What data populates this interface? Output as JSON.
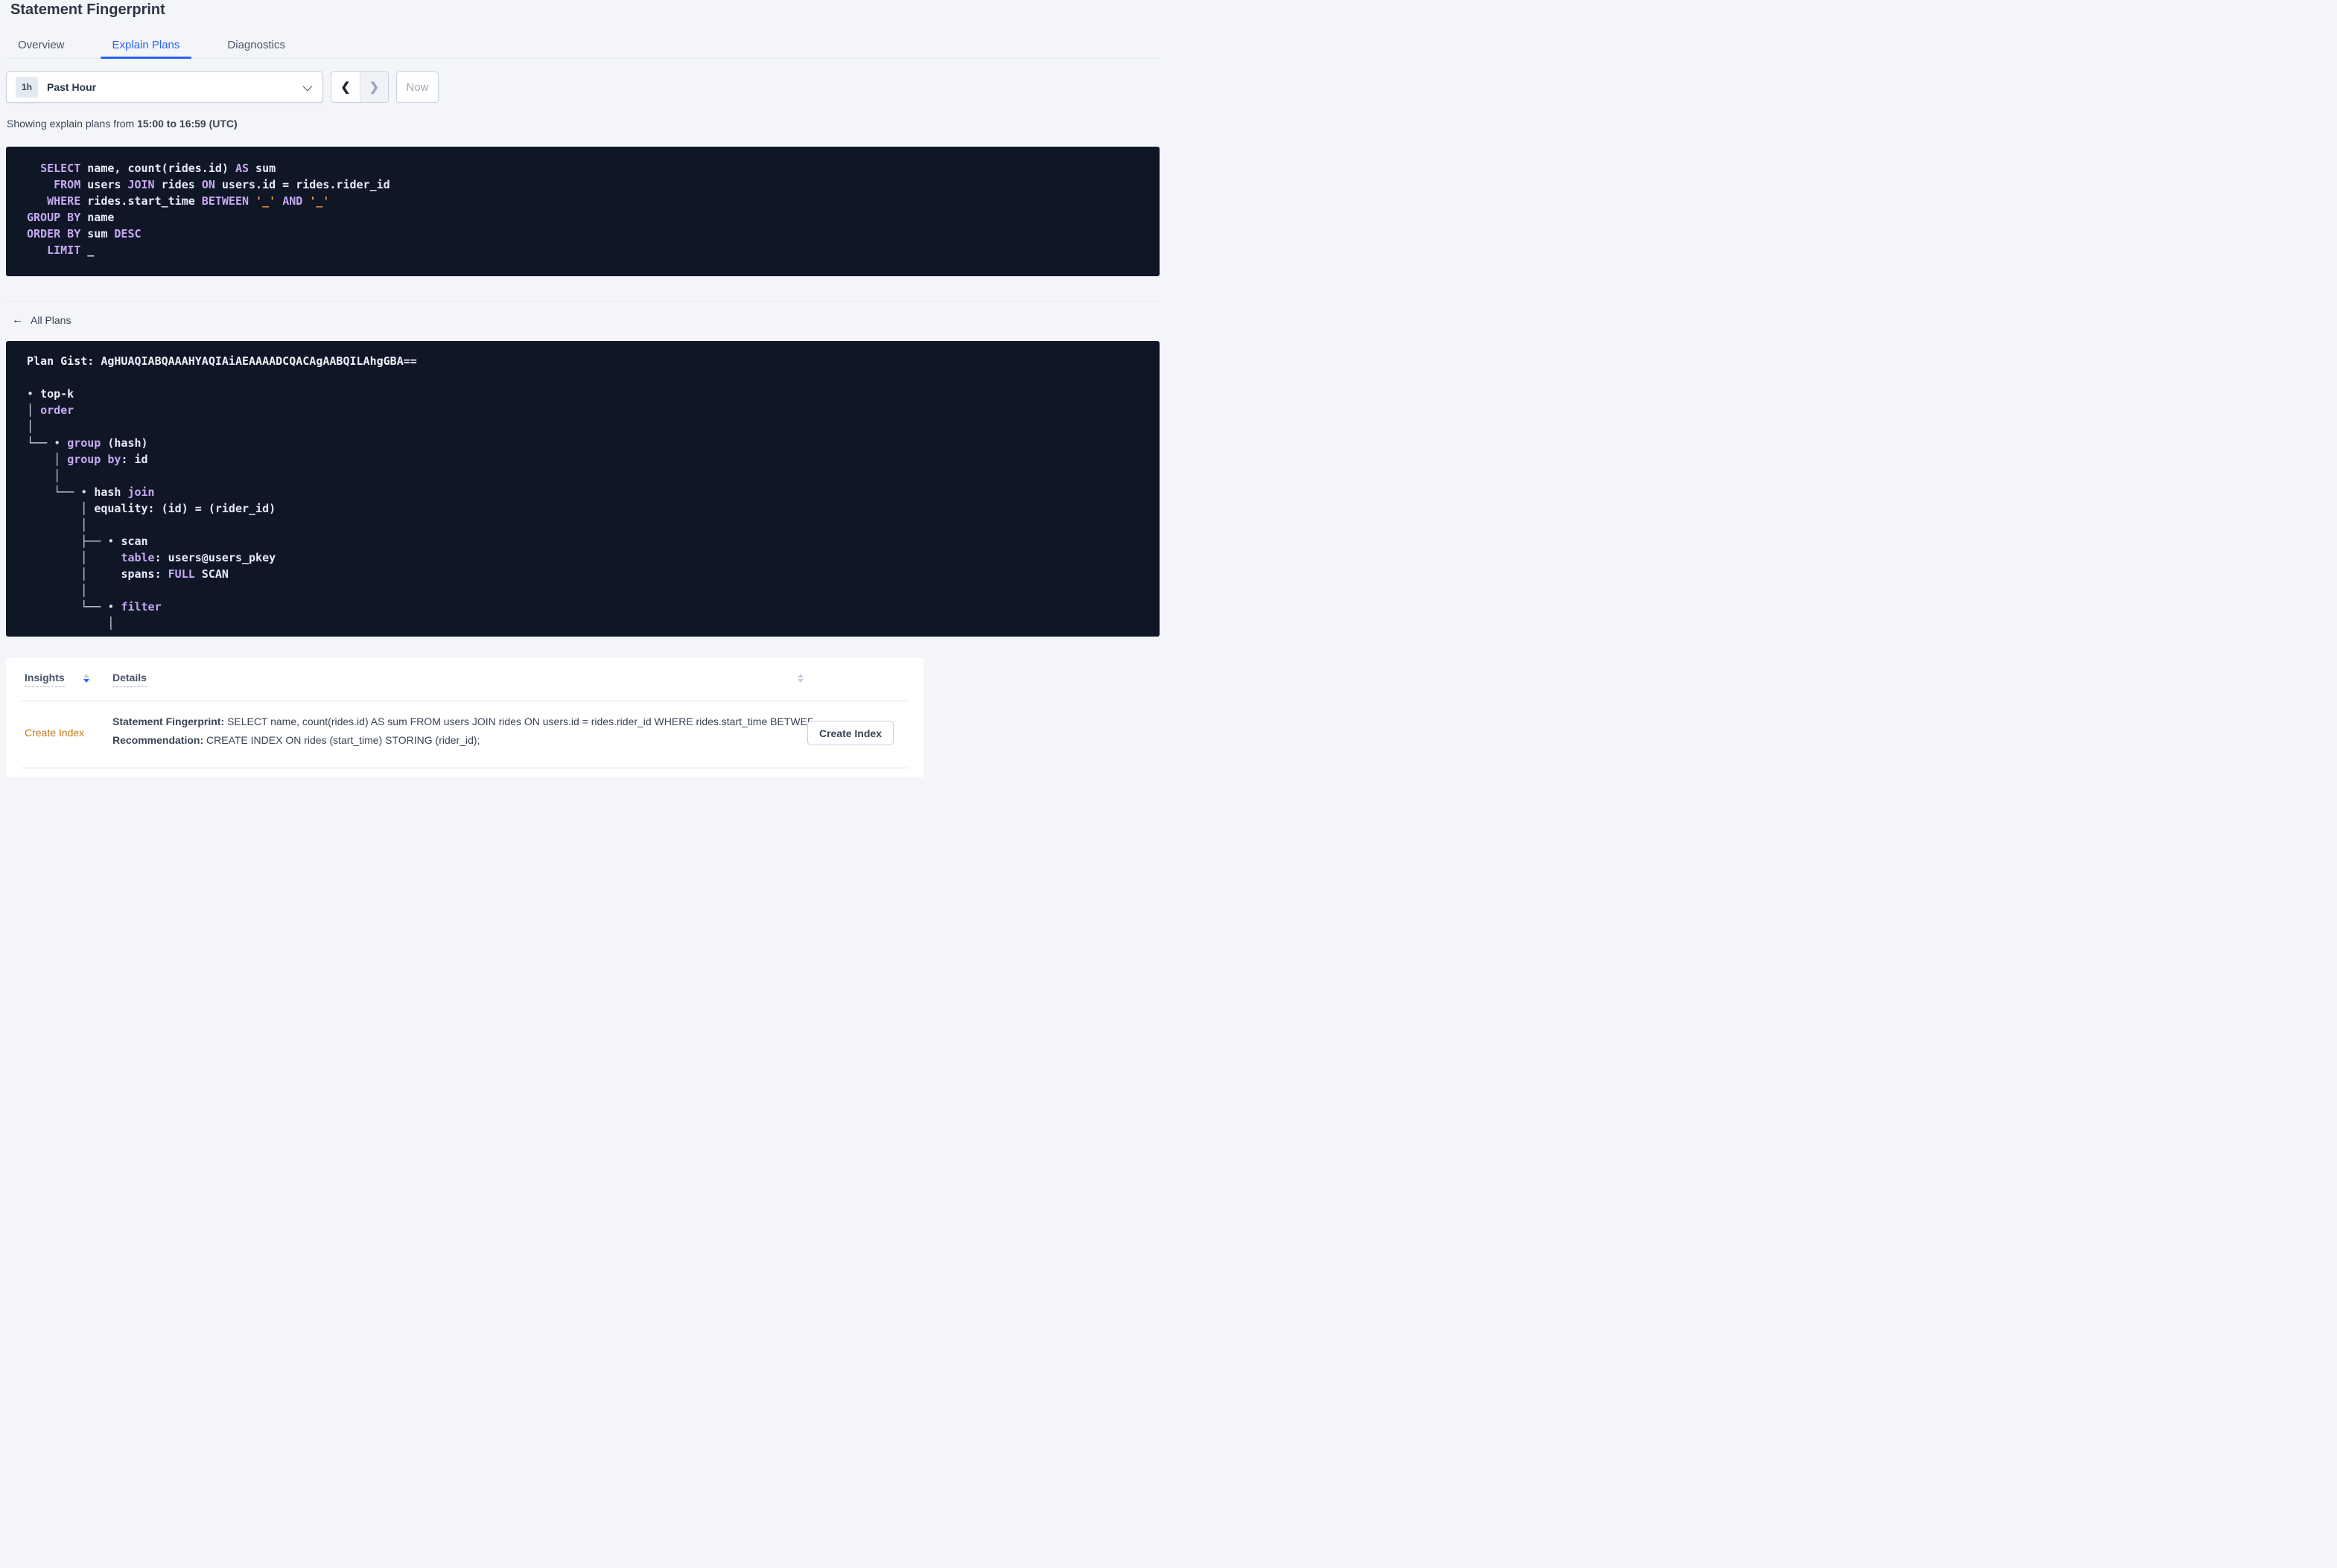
{
  "page": {
    "title": "Statement Fingerprint"
  },
  "tabs": [
    {
      "label": "Overview",
      "active": false
    },
    {
      "label": "Explain Plans",
      "active": true
    },
    {
      "label": "Diagnostics",
      "active": false
    }
  ],
  "time_picker": {
    "badge": "1h",
    "label": "Past Hour",
    "prev_icon": "❮",
    "next_icon": "❯",
    "now_label": "Now"
  },
  "showing": {
    "prefix": "Showing explain plans from ",
    "range": "15:00 to 16:59 (UTC)"
  },
  "sql": {
    "lines": [
      [
        [
          "  ",
          "id"
        ],
        [
          "SELECT",
          "kw"
        ],
        [
          " name, count(rides.id) ",
          "id"
        ],
        [
          "AS",
          "kw"
        ],
        [
          " sum",
          "id"
        ]
      ],
      [
        [
          "    ",
          "id"
        ],
        [
          "FROM",
          "kw"
        ],
        [
          " users ",
          "id"
        ],
        [
          "JOIN",
          "kw"
        ],
        [
          " rides ",
          "id"
        ],
        [
          "ON",
          "kw"
        ],
        [
          " users.id = rides.rider_id",
          "id"
        ]
      ],
      [
        [
          "   ",
          "id"
        ],
        [
          "WHERE",
          "kw"
        ],
        [
          " rides.start_time ",
          "id"
        ],
        [
          "BETWEEN",
          "kw"
        ],
        [
          " ",
          "id"
        ],
        [
          "'_'",
          "lit"
        ],
        [
          " ",
          "id"
        ],
        [
          "AND",
          "kw"
        ],
        [
          " ",
          "id"
        ],
        [
          "'_'",
          "lit"
        ]
      ],
      [
        [
          "GROUP BY",
          "kw"
        ],
        [
          " name",
          "id"
        ]
      ],
      [
        [
          "ORDER BY",
          "kw"
        ],
        [
          " sum ",
          "id"
        ],
        [
          "DESC",
          "kw"
        ]
      ],
      [
        [
          "   ",
          "id"
        ],
        [
          "LIMIT",
          "kw"
        ],
        [
          " _",
          "id"
        ]
      ]
    ]
  },
  "all_plans": {
    "label": "All Plans",
    "arrow_icon": "←"
  },
  "plan": {
    "gist": "AgHUAQIABQAAAHYAQIAiAEAAAADCQACAgAABQILAhgGBA==",
    "lines": [
      [
        [
          "Plan Gist: AgHUAQIABQAAAHYAQIAiAEAAAADCQACAgAABQILAhgGBA==",
          "b"
        ]
      ],
      [
        [
          "",
          ""
        ]
      ],
      [
        [
          "• ",
          "ln"
        ],
        [
          "top-k",
          "b"
        ]
      ],
      [
        [
          "│ ",
          "ln"
        ],
        [
          "order",
          "kw"
        ]
      ],
      [
        [
          "│",
          "ln"
        ]
      ],
      [
        [
          "└── ",
          "ln"
        ],
        [
          "• ",
          "ln"
        ],
        [
          "group",
          "kw"
        ],
        [
          " (hash)",
          "id"
        ]
      ],
      [
        [
          "    ",
          "id"
        ],
        [
          "│ ",
          "ln"
        ],
        [
          "group by",
          "kw"
        ],
        [
          ": id",
          "id"
        ]
      ],
      [
        [
          "    │",
          "ln"
        ]
      ],
      [
        [
          "    ",
          "id"
        ],
        [
          "└── ",
          "ln"
        ],
        [
          "• ",
          "ln"
        ],
        [
          "hash ",
          "id"
        ],
        [
          "join",
          "kw"
        ]
      ],
      [
        [
          "        ",
          "id"
        ],
        [
          "│ ",
          "ln"
        ],
        [
          "equality: (id) = (rider_id)",
          "id"
        ]
      ],
      [
        [
          "        │",
          "ln"
        ]
      ],
      [
        [
          "        ",
          "id"
        ],
        [
          "├── ",
          "ln"
        ],
        [
          "• ",
          "ln"
        ],
        [
          "scan",
          "id"
        ]
      ],
      [
        [
          "        ",
          "id"
        ],
        [
          "│     ",
          "ln"
        ],
        [
          "table",
          "kw"
        ],
        [
          ": users@users_pkey",
          "id"
        ]
      ],
      [
        [
          "        ",
          "id"
        ],
        [
          "│     ",
          "ln"
        ],
        [
          "spans: ",
          "id"
        ],
        [
          "FULL",
          "kw"
        ],
        [
          " SCAN",
          "id"
        ]
      ],
      [
        [
          "        │",
          "ln"
        ]
      ],
      [
        [
          "        ",
          "id"
        ],
        [
          "└── ",
          "ln"
        ],
        [
          "• ",
          "ln"
        ],
        [
          "filter",
          "kw"
        ]
      ],
      [
        [
          "            │",
          "ln"
        ]
      ]
    ]
  },
  "insights_table": {
    "columns": [
      {
        "label": "Insights",
        "sort": "desc"
      },
      {
        "label": "Details",
        "sort": "none"
      }
    ],
    "rows": [
      {
        "insight": "Create Index",
        "line1_label": "Statement Fingerprint:",
        "line1_text": " SELECT name, count(rides.id) AS sum FROM users JOIN rides ON users.id = rides.rider_id WHERE rides.start_time BETWEEN '_…",
        "line2_label": "Recommendation:",
        "line2_text": " CREATE INDEX ON rides (start_time) STORING (rider_id);",
        "action_label": "Create Index"
      }
    ]
  },
  "colors": {
    "accent_blue": "#2962ff",
    "insight_orange": "#c4761a",
    "code_background": "#0f1626",
    "code_keyword": "#c7a9f2",
    "code_literal": "#ef9b3c",
    "code_text": "#e7ebf4",
    "page_background": "#f4f5f8"
  }
}
